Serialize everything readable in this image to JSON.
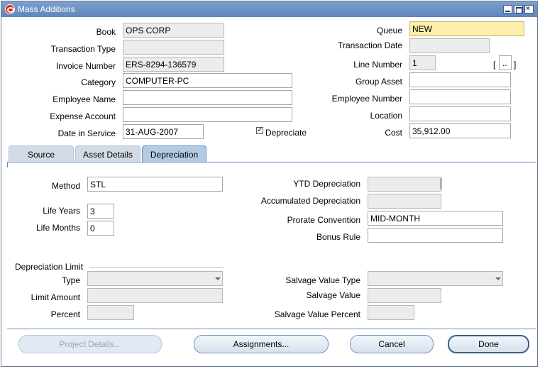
{
  "window": {
    "title": "Mass Additions"
  },
  "header": {
    "book_label": "Book",
    "book_value": "OPS CORP",
    "queue_label": "Queue",
    "queue_value": "NEW",
    "transaction_type_label": "Transaction Type",
    "transaction_type_value": "",
    "transaction_date_label": "Transaction Date",
    "transaction_date_value": "",
    "invoice_number_label": "Invoice Number",
    "invoice_number_value": "ERS-8294-136579",
    "line_number_label": "Line Number",
    "line_number_value": "1",
    "flex_open": "[",
    "flex_dots": "..",
    "flex_close": "]",
    "category_label": "Category",
    "category_value": "COMPUTER-PC",
    "group_asset_label": "Group Asset",
    "group_asset_value": "",
    "employee_name_label": "Employee Name",
    "employee_name_value": "",
    "employee_number_label": "Employee Number",
    "employee_number_value": "",
    "expense_account_label": "Expense Account",
    "expense_account_value": "",
    "location_label": "Location",
    "location_value": "",
    "date_in_service_label": "Date in Service",
    "date_in_service_value": "31-AUG-2007",
    "depreciate_label": "Depreciate",
    "depreciate_checked": true,
    "cost_label": "Cost",
    "cost_value": "35,912.00"
  },
  "tabs": [
    {
      "label": "Source",
      "active": false
    },
    {
      "label": "Asset Details",
      "active": false
    },
    {
      "label": "Depreciation",
      "active": true
    }
  ],
  "depreciation": {
    "method_label": "Method",
    "method_value": "STL",
    "ytd_label": "YTD Depreciation",
    "ytd_value": "",
    "accum_label": "Accumulated Depreciation",
    "accum_value": "",
    "life_years_label": "Life Years",
    "life_years_value": "3",
    "life_months_label": "Life Months",
    "life_months_value": "0",
    "prorate_label": "Prorate Convention",
    "prorate_value": "MID-MONTH",
    "bonus_label": "Bonus Rule",
    "bonus_value": ""
  },
  "limits": {
    "group_label": "Depreciation Limit",
    "type_label": "Type",
    "type_value": "",
    "limit_amount_label": "Limit Amount",
    "limit_amount_value": "",
    "percent_label": "Percent",
    "percent_value": "",
    "salvage_type_label": "Salvage Value Type",
    "salvage_type_value": "",
    "salvage_value_label": "Salvage Value",
    "salvage_value_value": "",
    "salvage_percent_label": "Salvage Value Percent",
    "salvage_percent_value": ""
  },
  "buttons": {
    "project_details": "Project Details...",
    "assignments": "Assignments...",
    "cancel": "Cancel",
    "done": "Done"
  },
  "colors": {
    "title_bar": "#6a8fc4",
    "queue_field": "#fdeeab",
    "active_tab": "#b4cbe4"
  },
  "icons": {
    "app": "oracle-icon",
    "minimize": "minimize-icon",
    "maximize": "maximize-icon",
    "close": "close-icon"
  }
}
